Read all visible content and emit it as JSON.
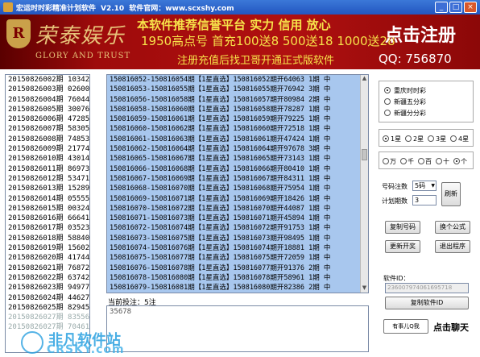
{
  "window": {
    "title": "宏运时时彩精准计划软件",
    "version": "V2.10",
    "website": "软件官网：www.scxshy.com"
  },
  "banner": {
    "logo_letter": "R",
    "brand_cn": "荣泰娱乐",
    "brand_en": "GLORY AND TRUST",
    "line1": "本软件推荐信誉平台  实力  信用  放心",
    "line2": "1950高点号 首充100送8 500送18 1000送28",
    "line3": "注册充值后找卫哥开通正式版软件",
    "register": "点击注册",
    "qq": "QQ:   756870"
  },
  "history": [
    "20150826002期 10342",
    "20150826003期 02600",
    "20150826004期 76044",
    "20150826005期 30076",
    "20150826006期 47285",
    "20150826007期 58305",
    "20150826008期 74853",
    "20150826009期 21774",
    "20150826010期 43014",
    "20150826011期 86973",
    "20150826012期 53471",
    "20150826013期 15289",
    "20150826014期 05555",
    "20150826015期 00324",
    "20150826016期 66641",
    "20150826017期 03523",
    "20150826018期 58840",
    "20150826019期 15602",
    "20150826020期 41744",
    "20150826021期 76872",
    "20150826022期 63742",
    "20150826023期 94977",
    "20150826024期 44627",
    "20150826025期 82945",
    "20150826027期 83556",
    "20150826027期 70461"
  ],
  "plans": [
    "150816052-150816054期【1星直选】150816052期开64063 1期 中",
    "150816053-150816055期【1星直选】150816055期开76942 3期 中",
    "150816056-150816058期【1星直选】150816057期开80984 2期 中",
    "150816058-150816060期【1星直选】150816058期开78287 1期 中",
    "150816059-150816061期【1星直选】150816059期开79225 1期 中",
    "150816060-150816062期【1星直选】150816060期开72518 1期 中",
    "150816061-150816063期【1星直选】150816061期开47424 1期 中",
    "150816062-150816064期【1星直选】150816064期开97678 3期 中",
    "150816065-150816067期【1星直选】150816065期开73143 1期 中",
    "150816066-150816068期【1星直选】150816066期开80410 1期 中",
    "150816067-150816069期【1星直选】150816067期开84311 1期 中",
    "150816068-150816070期【1星直选】150816068期开75954 1期 中",
    "150816069-150816071期【1星直选】150816069期开18426 1期 中",
    "150816070-150816072期【1星直选】150816070期开44087 1期 中",
    "150816071-150816073期【1星直选】150816071期开45894 1期 中",
    "150816072-150816074期【1星直选】150816072期开91753 1期 中",
    "150816073-150816075期【1星直选】150816073期开98495 1期 中",
    "150816074-150816076期【1星直选】150816074期开18881 1期 中",
    "150816075-150816077期【1星直选】150816075期开72059 1期 中",
    "150816076-150816078期【1星直选】150816077期开91376 2期 中",
    "150816078-150816080期【1星直选】150816078期开58961 1期 中",
    "150816079-150816081期【1星直选】150816080期开82386 2期 中"
  ],
  "current": {
    "label": "当前投注：5注",
    "value": "35678"
  },
  "lottery_options": [
    {
      "label": "重庆时时彩",
      "selected": true
    },
    {
      "label": "新疆五分彩",
      "selected": false
    },
    {
      "label": "新疆分分彩",
      "selected": false
    }
  ],
  "star_options": [
    {
      "label": "1星",
      "selected": true
    },
    {
      "label": "2星",
      "selected": false
    },
    {
      "label": "3星",
      "selected": false
    },
    {
      "label": "4星",
      "selected": false
    }
  ],
  "position_options": [
    {
      "label": "万",
      "selected": false
    },
    {
      "label": "千",
      "selected": false
    },
    {
      "label": "百",
      "selected": false
    },
    {
      "label": "十",
      "selected": false
    },
    {
      "label": "个",
      "selected": true
    }
  ],
  "settings": {
    "count_label": "号码注数",
    "count_value": "5码",
    "period_label": "计划期数",
    "period_value": "3",
    "refresh": "刷新"
  },
  "buttons": {
    "copy_numbers": "复制号码",
    "change_formula": "换个公式",
    "update": "更新开奖",
    "exit": "退出程序"
  },
  "software_id": {
    "label": "软件ID：",
    "value": "236007974061695718",
    "copy": "复制软件ID"
  },
  "chat": {
    "label": "点击聊天",
    "qq_badge": "有事儿Q我"
  },
  "watermark": {
    "cn": "非凡软件站",
    "en": "CRSKY.com"
  }
}
